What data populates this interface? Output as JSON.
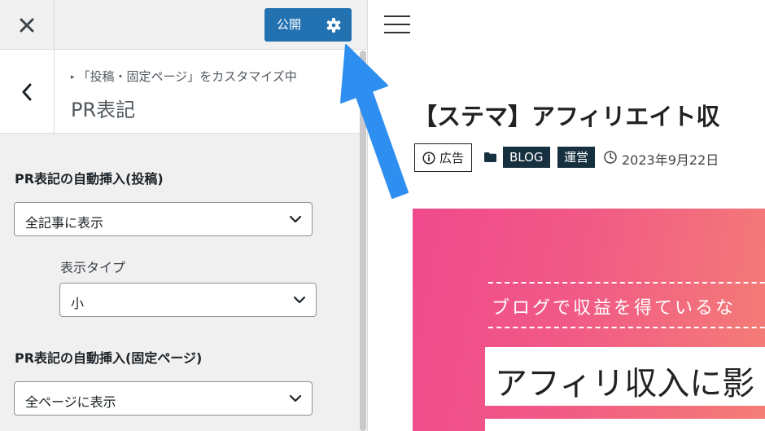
{
  "customizer": {
    "close_icon": "close-icon",
    "publish_label": "公開",
    "publish_settings_icon": "gear-icon",
    "back_icon": "chevron-left-icon",
    "breadcrumb_marker": "▸",
    "breadcrumb": "「投稿・固定ページ」をカスタマイズ中",
    "section_title": "PR表記",
    "controls": [
      {
        "label": "PR表記の自動挿入(投稿)",
        "selected": "全記事に表示"
      },
      {
        "label": "表示タイプ",
        "selected": "小"
      },
      {
        "label": "PR表記の自動挿入(固定ページ)",
        "selected": "全ページに表示"
      }
    ],
    "colors": {
      "publish_button": "#2271b1",
      "panel_bg": "#f0f0f1"
    }
  },
  "preview": {
    "menu_icon": "hamburger-icon",
    "post_title": "【ステマ】アフィリエイト収",
    "pr_badge_icon": "info-icon",
    "pr_badge_label": "広告",
    "category_icon": "folder-icon",
    "categories": [
      "BLOG",
      "運営"
    ],
    "date_icon": "clock-icon",
    "date": "2023年9月22日",
    "eyecatch": {
      "tagline": "ブログで収益を得ているな",
      "headline": "アフィリ収入に影"
    },
    "colors": {
      "category_tag": "#17303f",
      "eyecatch_start": "#ef4a8c",
      "eyecatch_end": "#f47f75"
    }
  },
  "annotation": {
    "arrow_color": "#2f8ff0"
  }
}
